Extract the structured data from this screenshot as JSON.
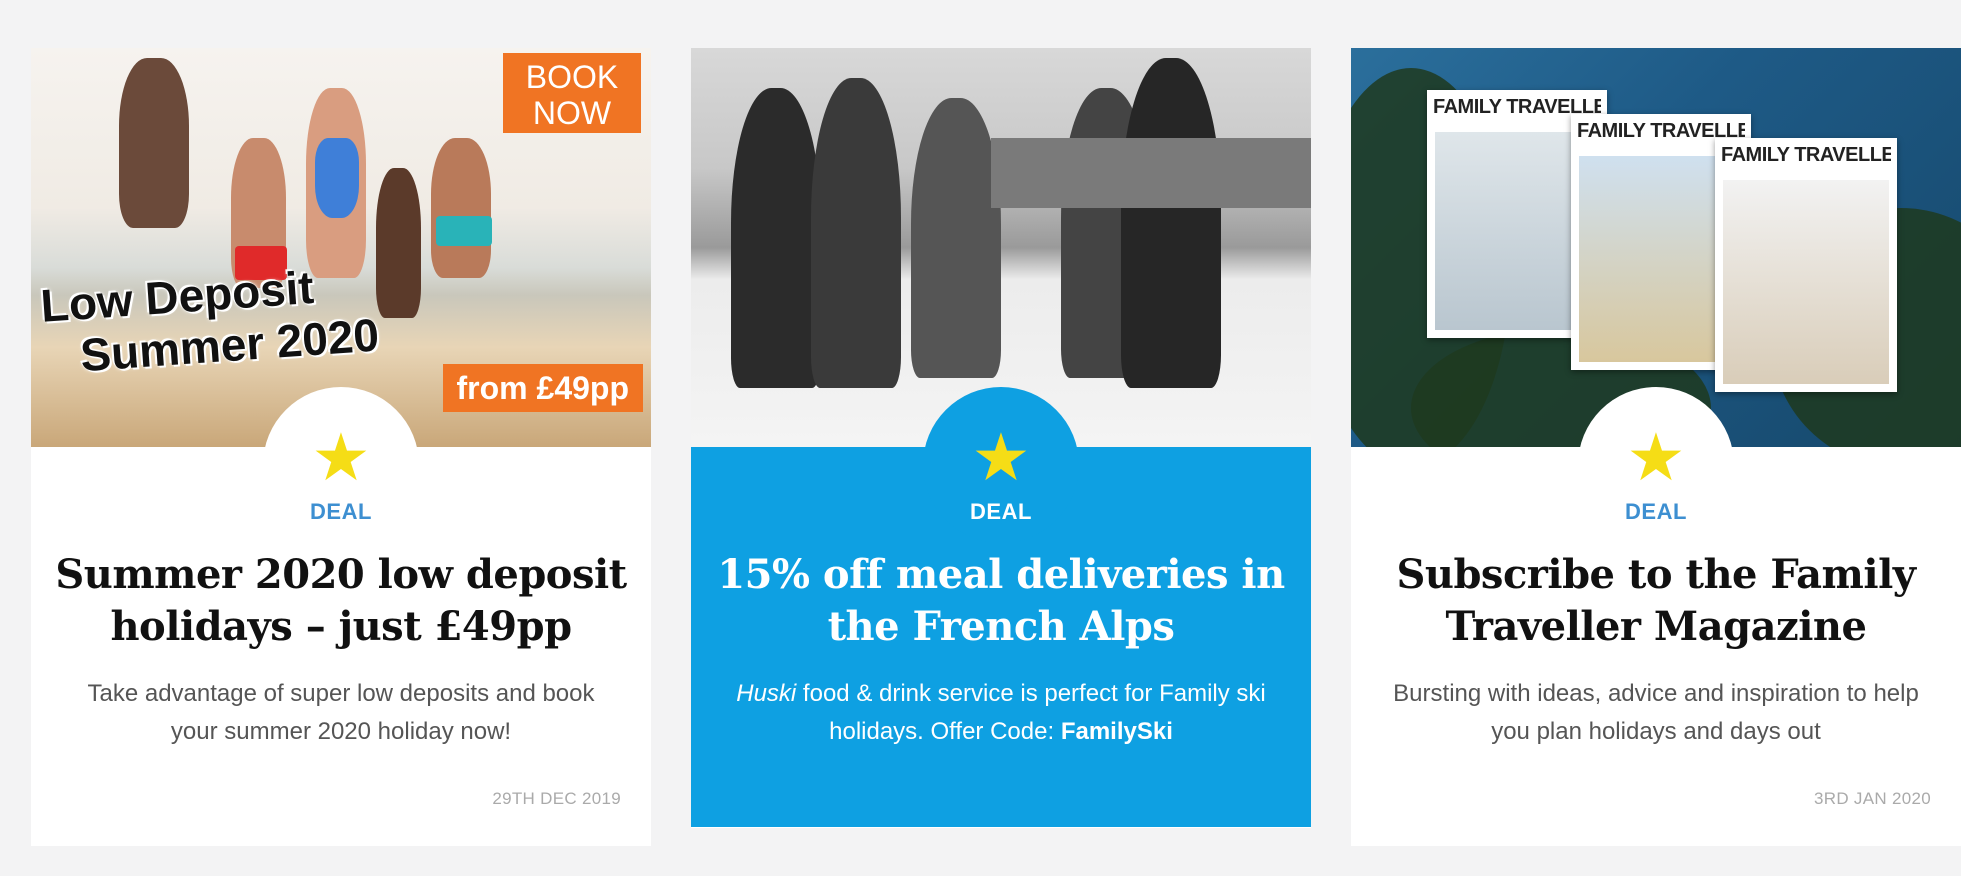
{
  "cards": [
    {
      "image": {
        "book_now_line1": "BOOK",
        "book_now_line2": "NOW",
        "headline_line1": "Low Deposit",
        "headline_line2": "Summer 2020",
        "price": "from £49pp"
      },
      "star": "★",
      "tag": "DEAL",
      "title": "Summer 2020 low deposit holidays – just £49pp",
      "description": "Take advantage of super low deposits and book your summer 2020 holiday now!",
      "date": "29TH DEC 2019"
    },
    {
      "star": "★",
      "tag": "DEAL",
      "title": "15% off meal deliveries in the French Alps",
      "description_italic": "Huski",
      "description_rest": " food & drink service is perfect for Family ski holidays. Offer Code: ",
      "offer_code": "FamilySki"
    },
    {
      "image": {
        "magazine_title": "FAMILY TRAVELLER"
      },
      "star": "★",
      "tag": "DEAL",
      "title": "Subscribe to the Family Traveller Magazine",
      "description": "Bursting with ideas, advice and inspiration to help you plan holidays and days out",
      "date": "3RD JAN 2020"
    }
  ],
  "colors": {
    "accent_blue": "#0ea0e2",
    "deal_blue": "#3d8fd1",
    "orange": "#f07423",
    "star_yellow": "#f5dd16"
  }
}
